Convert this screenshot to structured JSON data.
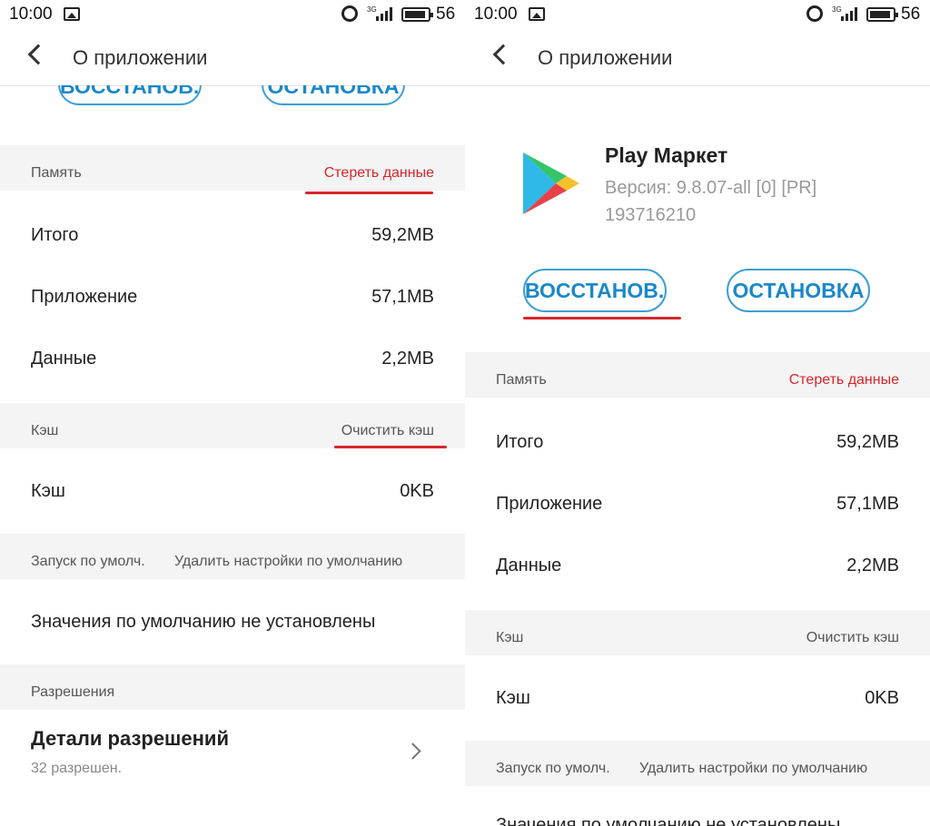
{
  "status_bar": {
    "time": "10:00",
    "network": "3G",
    "battery": "56"
  },
  "header": {
    "title": "О приложении"
  },
  "app": {
    "name": "Play Маркет",
    "version": "Версия: 9.8.07-all [0] [PR]",
    "build": "193716210"
  },
  "buttons": {
    "restore": "ВОССТАНОВ...",
    "stop": "ОСТАНОВКА"
  },
  "memory": {
    "label": "Память",
    "action": "Стереть данные",
    "rows": [
      {
        "key": "Итого",
        "value": "59,2MB"
      },
      {
        "key": "Приложение",
        "value": "57,1MB"
      },
      {
        "key": "Данные",
        "value": "2,2MB"
      }
    ]
  },
  "cache": {
    "label": "Кэш",
    "action": "Очистить кэш",
    "row_key": "Кэш",
    "row_value": "0KB"
  },
  "defaults": {
    "label": "Запуск по умолч.",
    "action": "Удалить настройки по умолчанию",
    "value": "Значения по умолчанию не установлены",
    "value_cut": "Значения по умолчанию не установлены"
  },
  "permissions": {
    "label": "Разрешения",
    "title": "Детали разрешений",
    "subtitle": "32 разрешен."
  },
  "colors": {
    "accent_blue": "#1a88c9",
    "danger_red": "#d7262b",
    "section_bg": "#f4f4f4"
  }
}
